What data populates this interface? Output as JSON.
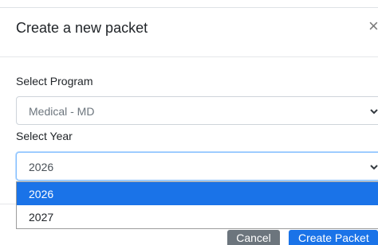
{
  "modal": {
    "title": "Create a new packet",
    "close_glyph": "×"
  },
  "program": {
    "label": "Select Program",
    "value": "Medical - MD"
  },
  "year": {
    "label": "Select Year",
    "value": "2026",
    "options": [
      "2026",
      "2027"
    ],
    "highlighted_index": 0
  },
  "footer": {
    "cancel_label": "Cancel",
    "create_label": "Create Packet"
  },
  "colors": {
    "accent": "#1a73e8",
    "secondary": "#6c757d",
    "focus_border": "#80bdff"
  }
}
